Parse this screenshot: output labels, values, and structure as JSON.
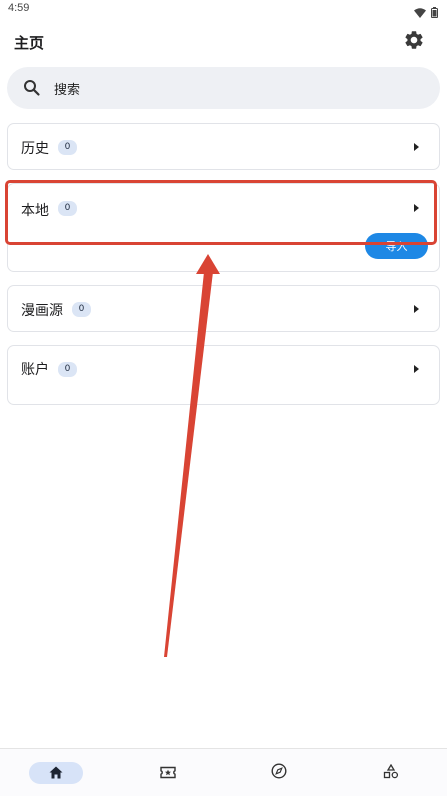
{
  "status_bar": {
    "time": "4:59"
  },
  "header": {
    "title": "主页"
  },
  "search": {
    "placeholder": "搜索"
  },
  "sections": [
    {
      "title": "历史",
      "count": "0"
    },
    {
      "title": "本地",
      "count": "0",
      "action_label": "导入"
    },
    {
      "title": "漫画源",
      "count": "0"
    },
    {
      "title": "账户",
      "count": "0"
    }
  ],
  "bottom_nav": {
    "items": [
      {
        "icon": "home-icon",
        "active": true
      },
      {
        "icon": "ticket-star-icon",
        "active": false
      },
      {
        "icon": "compass-icon",
        "active": false
      },
      {
        "icon": "categories-icon",
        "active": false
      }
    ]
  },
  "colors": {
    "accent": "#1e88e5",
    "badge_bg": "#dbe5f5",
    "annotation": "#d94434",
    "search_bg": "#eef0f4"
  }
}
